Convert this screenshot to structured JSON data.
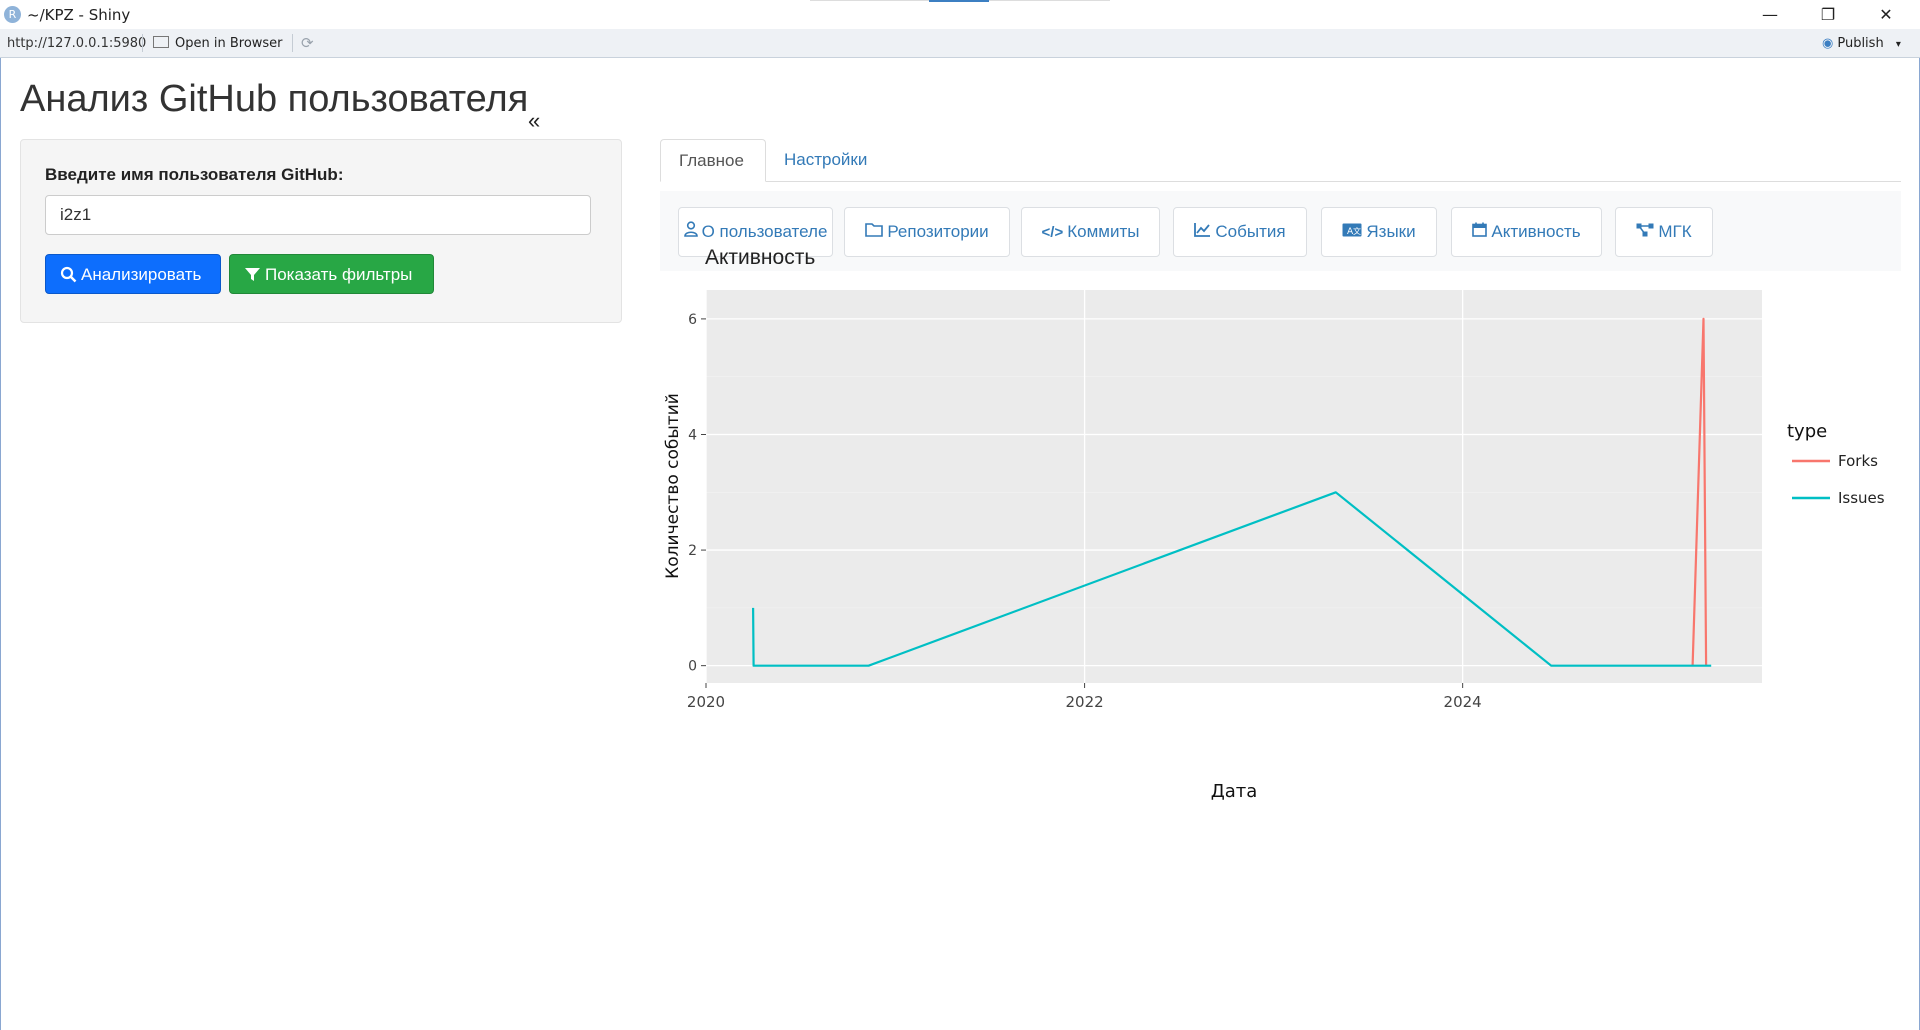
{
  "window": {
    "title": "~/KPZ - Shiny",
    "logo_letter": "R",
    "minimize": "—",
    "restore": "❐",
    "close": "✕"
  },
  "addressbar": {
    "url": "http://127.0.0.1:5980",
    "open_in_browser": "Open in Browser",
    "publish": "Publish",
    "publish_caret": "▾"
  },
  "app": {
    "title": "Анализ GitHub пользователя",
    "collapse_icon": "«"
  },
  "sidebar": {
    "username_label": "Введите имя пользователя GitHub:",
    "username_value": "i2z1",
    "analyze_button": "Анализировать",
    "filters_button": "Показать фильтры"
  },
  "tabs": [
    {
      "label": "Главное",
      "active": true
    },
    {
      "label": "Настройки",
      "active": false
    }
  ],
  "nav_buttons": [
    {
      "label": "О пользователе",
      "icon": "user-icon"
    },
    {
      "label": "Репозитории",
      "icon": "folder-icon"
    },
    {
      "label": "Коммиты",
      "icon": "code-icon"
    },
    {
      "label": "События",
      "icon": "line-chart-icon"
    },
    {
      "label": "Языки",
      "icon": "language-icon"
    },
    {
      "label": "Активность",
      "icon": "calendar-icon"
    },
    {
      "label": "МГК",
      "icon": "network-icon"
    }
  ],
  "chart_title": "Активность",
  "chart_data": {
    "type": "line",
    "title": "Активность",
    "xlabel": "Дата",
    "ylabel": "Количество событий",
    "xlim": [
      "2020-01-01",
      "2025-08-01"
    ],
    "ylim": [
      -0.3,
      6.5
    ],
    "x_ticks": [
      "2020",
      "2022",
      "2024"
    ],
    "y_ticks": [
      0,
      2,
      4,
      6
    ],
    "grid": true,
    "background": "#ebebeb",
    "legend_title": "type",
    "legend_position": "right",
    "series": [
      {
        "name": "Forks",
        "color": "#f8766d",
        "points": [
          [
            "2025-03-20",
            0
          ],
          [
            "2025-04-10",
            6
          ],
          [
            "2025-04-15",
            0
          ]
        ]
      },
      {
        "name": "Issues",
        "color": "#00bfc4",
        "points": [
          [
            "2020-04-01",
            1
          ],
          [
            "2020-04-02",
            0
          ],
          [
            "2020-11-10",
            0
          ],
          [
            "2023-05-01",
            3
          ],
          [
            "2024-06-20",
            0
          ],
          [
            "2025-04-25",
            0
          ]
        ]
      }
    ]
  }
}
